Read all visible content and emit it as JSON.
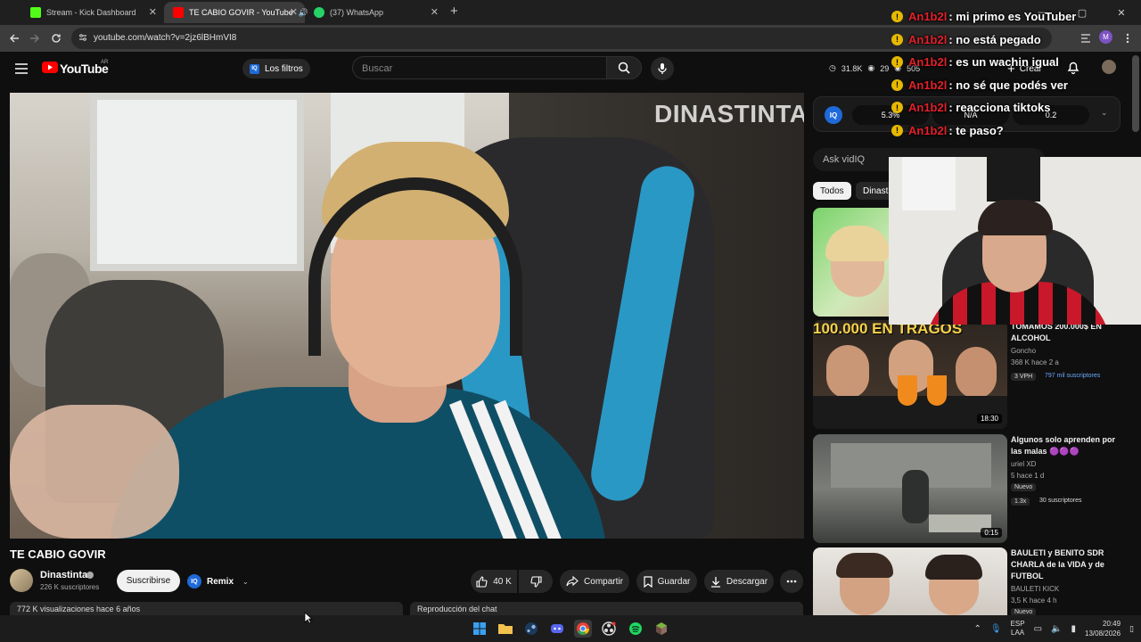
{
  "tabs": [
    {
      "label": "Stream - Kick Dashboard",
      "color": "#53fc18"
    },
    {
      "label": "TE CABIO GOVIR - YouTube",
      "color": "#ff0000"
    },
    {
      "label": "(37) WhatsApp",
      "color": "#25d366"
    }
  ],
  "address": {
    "url": "youtube.com/watch?v=2jz6lBHmVI8"
  },
  "profile_initial": "M",
  "yt": {
    "logo": "YouTube",
    "region": "AR",
    "filters_label": "Los filtros",
    "search_placeholder": "Buscar",
    "stats": {
      "views": "31.8K",
      "viewers": "29",
      "watching": "505"
    },
    "create_label": "Crear"
  },
  "video": {
    "watermark": "DINASTINTA",
    "title": "TE CABIO GOVIR",
    "channel": "Dinastinta",
    "subscribers": "226 K suscriptores",
    "subscribe_label": "Suscribirse",
    "remix_label": "Remix",
    "likes": "40 K",
    "share_label": "Compartir",
    "save_label": "Guardar",
    "download_label": "Descargar",
    "description_preview": "772 K visualizaciones  hace 6 años",
    "chat_replay": "Reproducción del chat"
  },
  "vidiq": {
    "logo": "IQ",
    "stat1": "5.3%",
    "stat2": "N/A",
    "stat3": "0.2",
    "ask_placeholder": "Ask vidIQ"
  },
  "chips": {
    "all": "Todos",
    "channel": "Dinastinta"
  },
  "related": [
    {
      "title": "",
      "channel": "",
      "meta": "",
      "duration": ""
    },
    {
      "title": "TOMAMOS 200.000$ EN ALCOHOL",
      "channel": "Goncho",
      "meta": "368 K  hace 2 a",
      "badge": "3 VPH",
      "subs": "797 mil suscriptores",
      "duration": "18:30",
      "thumb_text": "100.000 EN TRAGOS"
    },
    {
      "title": "Algunos solo aprenden por las malas 🟣🟣🟣",
      "channel": "uriel XD",
      "meta": "5  hace 1 d",
      "badge": "Nuevo",
      "badge2": "1.3x",
      "subs": "30 suscriptores",
      "duration": "0:15"
    },
    {
      "title": "BAULETI y BENITO SDR CHARLA de la VIDA y de FUTBOL",
      "channel": "BAULETI KICK",
      "meta": "3,5 K  hace 4 h",
      "badge": "Nuevo"
    }
  ],
  "chat": [
    {
      "user": "An1b2l",
      "msg": ": mi primo es YouTuber"
    },
    {
      "user": "An1b2l",
      "msg": ": no está pegado"
    },
    {
      "user": "An1b2l",
      "msg": ": es un wachin igual"
    },
    {
      "user": "An1b2l",
      "msg": ": no sé que podés ver"
    },
    {
      "user": "An1b2l",
      "msg": ": reacciona tiktoks"
    },
    {
      "user": "An1b2l",
      "msg": ": te paso?"
    }
  ],
  "taskbar": {
    "lang_top": "ESP",
    "lang_bottom": "LAA",
    "time": "20:49",
    "date": "13/08/2026"
  }
}
